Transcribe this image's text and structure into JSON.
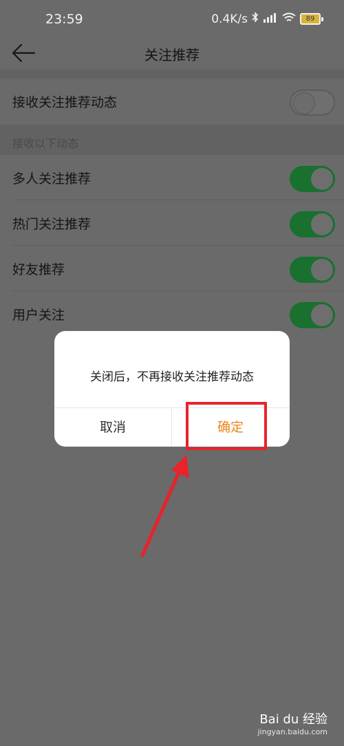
{
  "status_bar": {
    "time": "23:59",
    "network_speed": "0.4K/s",
    "battery": "89"
  },
  "header": {
    "title": "关注推荐",
    "back_icon": "back-arrow-icon"
  },
  "master_toggle": {
    "label": "接收关注推荐动态",
    "enabled": false
  },
  "section": {
    "label": "接收以下动态"
  },
  "items": [
    {
      "label": "多人关注推荐",
      "enabled": true
    },
    {
      "label": "热门关注推荐",
      "enabled": true
    },
    {
      "label": "好友推荐",
      "enabled": true
    },
    {
      "label": "用户关注",
      "enabled": true
    }
  ],
  "dialog": {
    "message": "关闭后，不再接收关注推荐动态",
    "cancel_label": "取消",
    "confirm_label": "确定"
  },
  "watermark": {
    "logo": "Bai du 经验",
    "url": "jingyan.baidu.com"
  },
  "colors": {
    "toggle_on": "#19702f",
    "confirm": "#e8861a",
    "annotation": "#e8232a"
  }
}
